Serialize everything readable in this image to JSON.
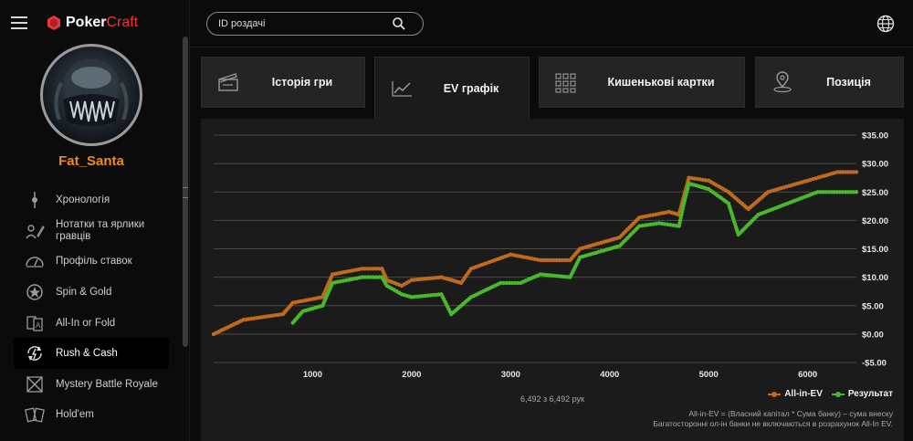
{
  "app": {
    "logo_main": "Poker",
    "logo_accent": "Craft"
  },
  "user": {
    "name": "Fat_Santa"
  },
  "search": {
    "placeholder": "ID роздачі"
  },
  "nav": [
    {
      "label": "Хронологія",
      "icon": "timeline-icon"
    },
    {
      "label": "Нотатки та ярлики гравців",
      "icon": "notes-icon"
    },
    {
      "label": "Профіль ставок",
      "icon": "bet-profile-icon"
    },
    {
      "label": "Spin & Gold",
      "icon": "spin-gold-icon"
    },
    {
      "label": "All-In or Fold",
      "icon": "allin-fold-icon"
    },
    {
      "label": "Rush & Cash",
      "icon": "rush-cash-icon",
      "active": true
    },
    {
      "label": "Mystery Battle Royale",
      "icon": "mystery-battle-icon"
    },
    {
      "label": "Hold'em",
      "icon": "holdem-icon"
    }
  ],
  "tabs": [
    {
      "label": "Історія гри",
      "icon": "clapper-icon"
    },
    {
      "label": "EV графік",
      "icon": "line-chart-icon",
      "active": true
    },
    {
      "label": "Кишенькові картки",
      "icon": "grid-icon"
    },
    {
      "label": "Позиція",
      "icon": "position-icon"
    }
  ],
  "chart_data": {
    "type": "line",
    "x_ticks": [
      "1000",
      "2000",
      "3000",
      "4000",
      "5000",
      "6000"
    ],
    "y_ticks": [
      "$35.00",
      "$30.00",
      "$25.00",
      "$20.00",
      "$15.00",
      "$10.00",
      "$5.00",
      "$0.00",
      "-$5.00"
    ],
    "xlim": [
      0,
      6492
    ],
    "ylim": [
      -5,
      35
    ],
    "grid": true,
    "legend_position": "bottom-right",
    "series": [
      {
        "name": "All-in-EV",
        "color": "#c06a1c",
        "x": [
          0,
          300,
          700,
          800,
          1100,
          1200,
          1500,
          1700,
          1750,
          1900,
          2000,
          2300,
          2500,
          2600,
          3000,
          3300,
          3600,
          3700,
          4100,
          4300,
          4600,
          4700,
          4800,
          5000,
          5200,
          5400,
          5600,
          6000,
          6300,
          6492
        ],
        "values": [
          0,
          2.5,
          3.5,
          5.5,
          6.5,
          10.5,
          11.5,
          11.5,
          9.5,
          8.5,
          9.5,
          10,
          9,
          11.5,
          14,
          13,
          13,
          15,
          17,
          20.5,
          21.5,
          21,
          27.5,
          27,
          25,
          22,
          25,
          27,
          28.5,
          28.5
        ]
      },
      {
        "name": "Результат",
        "color": "#4ab82c",
        "x": [
          800,
          900,
          1100,
          1200,
          1500,
          1700,
          1750,
          1900,
          2000,
          2300,
          2400,
          2600,
          2900,
          3100,
          3300,
          3600,
          3700,
          4100,
          4300,
          4500,
          4700,
          4750,
          4800,
          5000,
          5200,
          5300,
          5500,
          5800,
          6100,
          6492
        ],
        "values": [
          2,
          4,
          5,
          9,
          10,
          10,
          8.5,
          7,
          6.5,
          7,
          3.5,
          6.5,
          9,
          9,
          10.5,
          10,
          13.5,
          15.5,
          19,
          19.5,
          19,
          23,
          26.5,
          25.5,
          23,
          17.5,
          21,
          23,
          25,
          25
        ]
      }
    ]
  },
  "chart_info": {
    "count": "6,492 з 6,492 рук",
    "footnote_1": "All-in-EV = (Власний капітал * Сума банку) – сума внеску",
    "footnote_2": "Багатосторонні ол-ін банки не включаються в розрахунок All-In EV."
  }
}
